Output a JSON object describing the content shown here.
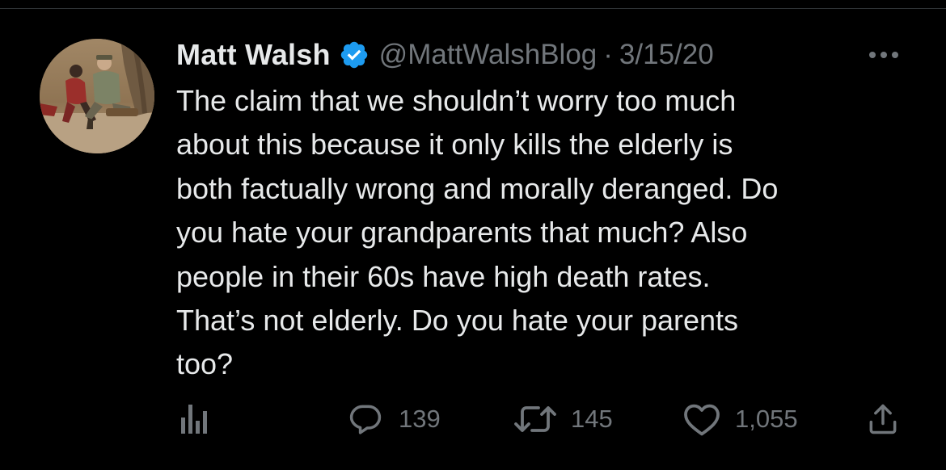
{
  "tweet": {
    "display_name": "Matt Walsh",
    "handle": "@MattWalshBlog",
    "separator": "·",
    "date": "3/15/20",
    "text": "The claim that we shouldn’t worry too much\nabout this because it only kills the elderly is\nboth factually wrong and morally deranged. Do\nyou hate your grandparents that much? Also\npeople in their 60s have high death rates.\nThat’s not elderly. Do you hate your parents\ntoo?",
    "verified": true
  },
  "actions": {
    "replies": "139",
    "retweets": "145",
    "likes": "1,055"
  },
  "icons": {
    "analytics": "analytics-icon",
    "reply": "reply-icon",
    "retweet": "retweet-icon",
    "like": "heart-icon",
    "share": "share-icon",
    "more": "more-icon",
    "verified": "verified-badge-icon"
  },
  "colors": {
    "background": "#000000",
    "primary_text": "#e7e9ea",
    "secondary_text": "#71767b",
    "verified_blue": "#1d9bf0",
    "divider": "#2f3336"
  }
}
